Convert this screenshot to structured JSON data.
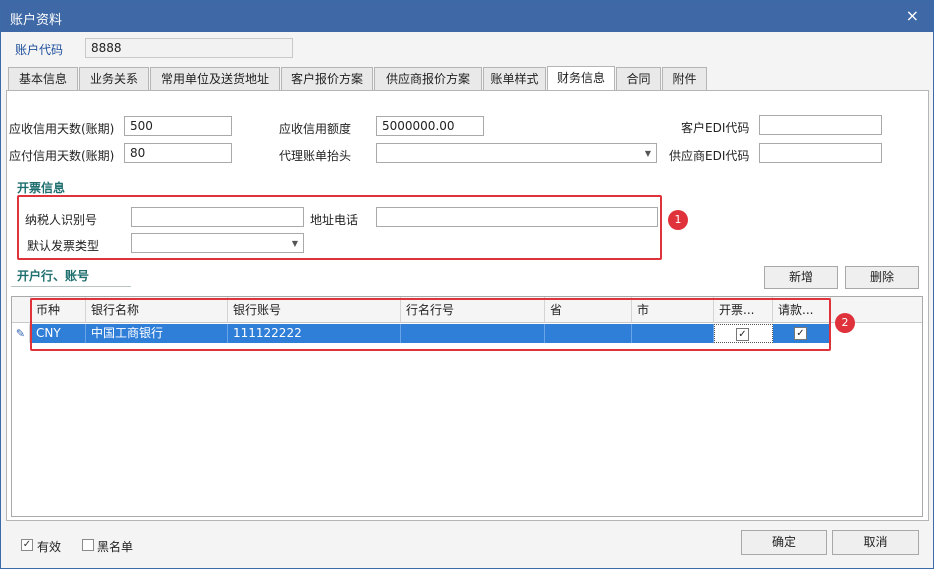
{
  "window": {
    "title": "账户资料",
    "close_icon": "×"
  },
  "account": {
    "code_label": "账户代码",
    "code_value": "8888"
  },
  "tabs": [
    {
      "label": "基本信息"
    },
    {
      "label": "业务关系"
    },
    {
      "label": "常用单位及送货地址"
    },
    {
      "label": "客户报价方案"
    },
    {
      "label": "供应商报价方案"
    },
    {
      "label": "账单样式"
    },
    {
      "label": "财务信息"
    },
    {
      "label": "合同"
    },
    {
      "label": "附件"
    }
  ],
  "finance": {
    "ar_days_label": "应收信用天数(账期)",
    "ar_days_value": "500",
    "ar_limit_label": "应收信用额度",
    "ar_limit_value": "5000000.00",
    "cust_edi_label": "客户EDI代码",
    "cust_edi_value": "",
    "ap_days_label": "应付信用天数(账期)",
    "ap_days_value": "80",
    "agent_header_label": "代理账单抬头",
    "agent_header_value": "",
    "supp_edi_label": "供应商EDI代码",
    "supp_edi_value": ""
  },
  "invoice": {
    "section_title": "开票信息",
    "taxpayer_label": "纳税人识别号",
    "taxpayer_value": "",
    "address_label": "地址电话",
    "address_value": "",
    "type_label": "默认发票类型",
    "type_value": "",
    "badge": "1"
  },
  "bank": {
    "section_title": "开户行、账号",
    "add_button": "新增",
    "delete_button": "删除",
    "badge": "2",
    "columns": [
      "币种",
      "银行名称",
      "银行账号",
      "行名行号",
      "省",
      "市",
      "开票...",
      "请款..."
    ],
    "rows": [
      {
        "currency": "CNY",
        "bank_name": "中国工商银行",
        "account_no": "111122222",
        "bank_code": "",
        "province": "",
        "city": "",
        "invoice_flag": "✓",
        "payment_flag": "✓"
      }
    ],
    "row_indicator": "✎"
  },
  "footer": {
    "valid_label": "有效",
    "valid_check": "✓",
    "blacklist_label": "黑名单",
    "blacklist_check": "",
    "ok_button": "确定",
    "cancel_button": "取消"
  },
  "colors": {
    "titlebar": "#3f69a6",
    "selection": "#2f7ed8",
    "annotation": "#e0323b",
    "section": "#1f6f6f"
  }
}
